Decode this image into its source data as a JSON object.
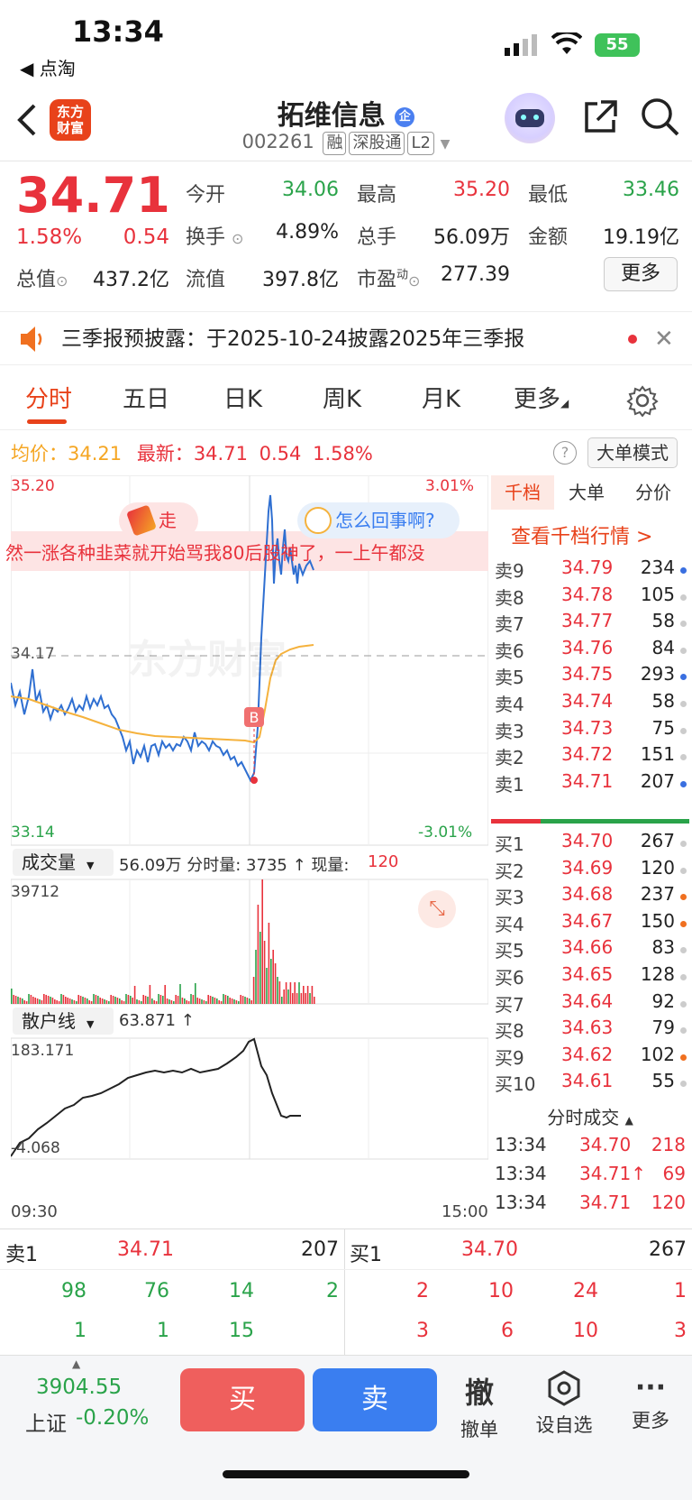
{
  "status": {
    "time": "13:34",
    "back_app": "◀ 点淘",
    "battery": "55"
  },
  "header": {
    "title": "拓维信息",
    "badge": "企",
    "code": "002261",
    "tags": [
      "融",
      "深股通",
      "L2"
    ],
    "logo_text": "东方\n财富"
  },
  "quote": {
    "price": "34.71",
    "pct": "1.58%",
    "chg": "0.54",
    "open_label": "今开",
    "open": "34.06",
    "high_label": "最高",
    "high": "35.20",
    "low_label": "最低",
    "low": "33.46",
    "turnover_label": "换手",
    "turnover": "4.89%",
    "vol_label": "总手",
    "vol": "56.09万",
    "amt_label": "金额",
    "amt": "19.19亿",
    "mcap_label": "总值",
    "mcap": "437.2亿",
    "float_label": "流值",
    "float": "397.8亿",
    "pe_label": "市盈",
    "pe_sup": "动",
    "pe": "277.39",
    "more": "更多"
  },
  "notice": {
    "text": "三季报预披露：于2025-10-24披露2025年三季报"
  },
  "tabs": [
    "分时",
    "五日",
    "日K",
    "周K",
    "月K",
    "更多"
  ],
  "stats": {
    "avg_label": "均价：",
    "avg": "34.21",
    "last_label": "最新：",
    "last": "34.71",
    "chg": "0.54",
    "pct": "1.58%",
    "mode": "大单模式"
  },
  "chart": {
    "ymax": "35.20",
    "ymin": "33.14",
    "pmax": "3.01%",
    "pmin": "-3.01%",
    "mid": "34.17",
    "bubble_go": "走",
    "bubble_ask": "怎么回事啊?",
    "scroll_text": "然一涨各种韭菜就开始骂我80后股神了，一上午都没",
    "watermark": "东方财富",
    "marker": "B",
    "vol_label": "成交量",
    "vol_info": "56.09万 分时量: 3735 ↑ 现量: ",
    "vol_now": "120",
    "vol_max": "39712",
    "retail_label": "散户线",
    "retail_val": "63.871 ↑",
    "retail_max": "183.171",
    "retail_min": "-4.068",
    "t_start": "09:30",
    "t_end": "15:00"
  },
  "book": {
    "tabs": [
      "千档",
      "大单",
      "分价"
    ],
    "link": "查看千档行情 >",
    "asks": [
      {
        "label": "卖9",
        "price": "34.79",
        "vol": "234",
        "dot": "#3a6fe0"
      },
      {
        "label": "卖8",
        "price": "34.78",
        "vol": "105",
        "dot": "#ccc"
      },
      {
        "label": "卖7",
        "price": "34.77",
        "vol": "58",
        "dot": "#ccc"
      },
      {
        "label": "卖6",
        "price": "34.76",
        "vol": "84",
        "dot": "#ccc"
      },
      {
        "label": "卖5",
        "price": "34.75",
        "vol": "293",
        "dot": "#3a6fe0"
      },
      {
        "label": "卖4",
        "price": "34.74",
        "vol": "58",
        "dot": "#ccc"
      },
      {
        "label": "卖3",
        "price": "34.73",
        "vol": "75",
        "dot": "#ccc"
      },
      {
        "label": "卖2",
        "price": "34.72",
        "vol": "151",
        "dot": "#ccc"
      },
      {
        "label": "卖1",
        "price": "34.71",
        "vol": "207",
        "dot": "#3a6fe0"
      }
    ],
    "bids": [
      {
        "label": "买1",
        "price": "34.70",
        "vol": "267",
        "dot": "#ccc"
      },
      {
        "label": "买2",
        "price": "34.69",
        "vol": "120",
        "dot": "#ccc"
      },
      {
        "label": "买3",
        "price": "34.68",
        "vol": "237",
        "dot": "#f07020"
      },
      {
        "label": "买4",
        "price": "34.67",
        "vol": "150",
        "dot": "#f07020"
      },
      {
        "label": "买5",
        "price": "34.66",
        "vol": "83",
        "dot": "#ccc"
      },
      {
        "label": "买6",
        "price": "34.65",
        "vol": "128",
        "dot": "#ccc"
      },
      {
        "label": "买7",
        "price": "34.64",
        "vol": "92",
        "dot": "#ccc"
      },
      {
        "label": "买8",
        "price": "34.63",
        "vol": "79",
        "dot": "#ccc"
      },
      {
        "label": "买9",
        "price": "34.62",
        "vol": "102",
        "dot": "#f07020"
      },
      {
        "label": "买10",
        "price": "34.61",
        "vol": "55",
        "dot": "#ccc"
      }
    ],
    "ticks_title": "分时成交",
    "ticks": [
      {
        "time": "13:34",
        "price": "34.70",
        "vol": "218",
        "vcolor": "#e8323c"
      },
      {
        "time": "13:34",
        "price": "34.71↑",
        "vol": "69",
        "vcolor": "#e8323c"
      },
      {
        "time": "13:34",
        "price": "34.71",
        "vol": "120",
        "vcolor": "#e8323c"
      }
    ]
  },
  "pan": {
    "sell_label": "卖1",
    "sell_price": "34.71",
    "sell_vol": "207",
    "buy_label": "买1",
    "buy_price": "34.70",
    "buy_vol": "267",
    "sell_row1": [
      "98",
      "76",
      "14",
      "2"
    ],
    "sell_row2": [
      "1",
      "1",
      "15",
      ""
    ],
    "buy_row1": [
      "2",
      "10",
      "24",
      "1"
    ],
    "buy_row2": [
      "3",
      "6",
      "10",
      "3"
    ]
  },
  "bottom": {
    "index": "3904.55",
    "index_name": "上证",
    "index_pct": "-0.20%",
    "buy": "买",
    "sell": "卖",
    "cancel_icon": "撤",
    "cancel": "撤单",
    "watch": "设自选",
    "more": "更多"
  }
}
